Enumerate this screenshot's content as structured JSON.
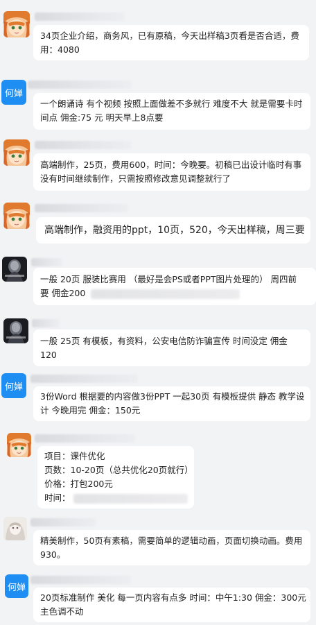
{
  "messages": [
    {
      "sender": "",
      "avatar": "anime-girl-icon",
      "lines": [
        "34页企业介绍，商务风，已有原稿，今天出样稿3页看是否合适，费",
        "用：4080"
      ]
    },
    {
      "sender": "何婵",
      "avatar": "text",
      "lines": [
        "一个朗诵诗 有个视频 按照上面做差不多就行 难度不大 就是需要卡时",
        "间点 佣金:75 元 明天早上8点要"
      ]
    },
    {
      "sender": "",
      "avatar": "anime-girl-icon",
      "lines": [
        "高端制作，25页，费用600，时间：今晚要。初稿已出设计临时有事",
        "没有时间继续制作，只需按照修改意见调整就行了"
      ]
    },
    {
      "sender": "",
      "avatar": "anime-girl-icon",
      "lines": [
        "高端制作，融资用的ppt，10页，520，今天出样稿，周三要"
      ]
    },
    {
      "sender": "",
      "avatar": "dark-portrait-icon",
      "lines": [
        "一般 20页  服装比赛用 （最好是会PS或者PPT图片处理的）  周四前",
        "要  佣金200"
      ]
    },
    {
      "sender": "",
      "avatar": "dark-portrait-icon",
      "lines": [
        "一般 25页   有模板，有资料，公安电信防诈骗宣传     时间没定   佣金",
        "120"
      ]
    },
    {
      "sender": "何婵",
      "avatar": "text",
      "lines": [
        "3份Word 根据要的内容做3份PPT  一起30页  有模板提供 静态 教学设",
        "计  今晚用完 佣金：150元"
      ]
    },
    {
      "sender": "",
      "avatar": "anime-girl-icon",
      "lines": [
        "项目：课件优化",
        "页数：10-20页（总共优化20页就行）",
        "价格：打包200元",
        "时间："
      ]
    },
    {
      "sender": "",
      "avatar": "pale-girl-icon",
      "lines": [
        "精美制作，50页有素稿，需要简单的逻辑动画，页面切换动画。费用",
        "930。"
      ]
    },
    {
      "sender": "何婵",
      "avatar": "text",
      "lines": [
        "20页标准制作 美化  每一页内容有点多 时间：中午1:30  佣金：300元",
        "主色调不动"
      ]
    }
  ]
}
